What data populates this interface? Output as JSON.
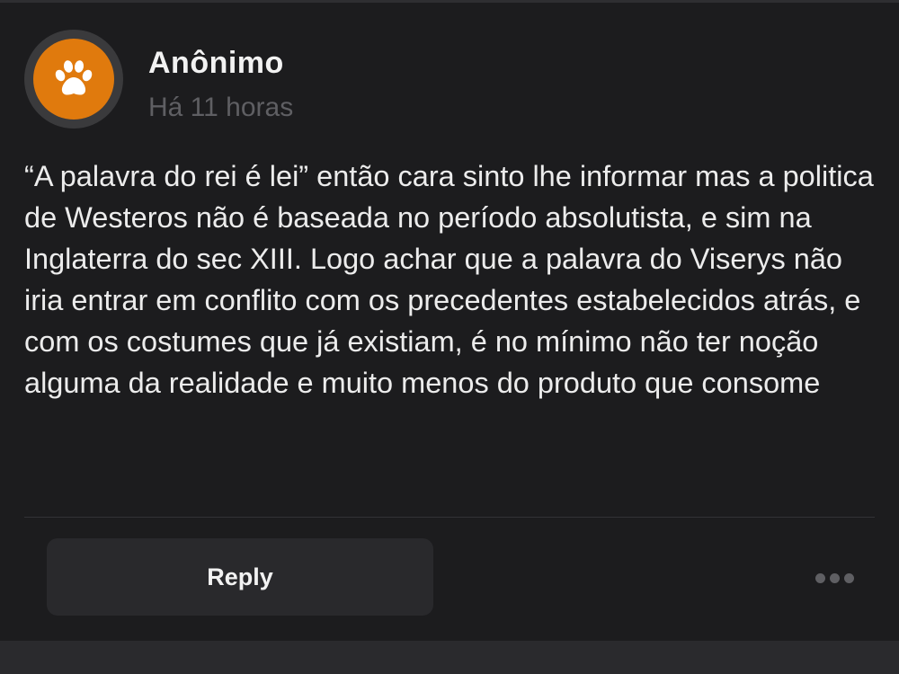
{
  "post": {
    "author": "Anônimo",
    "timestamp": "Há 11 horas",
    "avatar_icon": "paw-icon",
    "avatar_color": "#e07a0d",
    "body": "“A palavra do rei é lei” então cara sinto lhe informar mas a politica de Westeros não é baseada no período absolutista, e sim na Inglaterra do sec XIII. Logo achar que a palavra do Viserys não iria entrar em conflito com os precedentes estabelecidos atrás, e com os costumes que já existiam, é no mínimo não ter noção alguma da realidade e muito menos do produto que consome"
  },
  "actions": {
    "reply_label": "Reply",
    "more_icon": "more-dots-icon"
  }
}
